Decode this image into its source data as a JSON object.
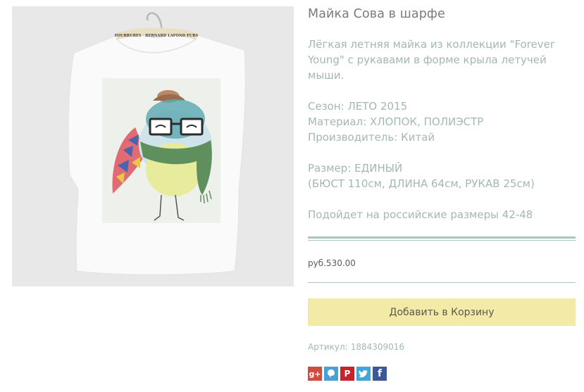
{
  "product": {
    "title": "Майка Сова в шарфе",
    "description": [
      "Лёгкая летняя майка из коллекции \"Forever Young\" с рукавами в форме крыла летучей мыши.",
      "",
      "Сезон: ЛЕТО 2015",
      "Материал: ХЛОПОК, ПОЛИЭСТР",
      "Производитель: Китай",
      "",
      "Размер: ЕДИНЫЙ",
      "(БЮСТ 110см, ДЛИНА 64см, РУКАВ 25см)",
      "",
      "Подойдет на российские размеры 42-48"
    ],
    "price": "руб.530.00",
    "add_to_cart_label": "Добавить в Корзину",
    "sku_label": "Артикул:",
    "sku_value": "1884309016",
    "hanger_label": "FOURRURES · BERNARD LAFOND FURS"
  },
  "social": [
    {
      "name": "google-plus-icon",
      "glyph": "g+"
    },
    {
      "name": "speech-bubble-icon",
      "glyph": ""
    },
    {
      "name": "pinterest-icon",
      "glyph": "P"
    },
    {
      "name": "twitter-icon",
      "glyph": ""
    },
    {
      "name": "facebook-icon",
      "glyph": "f"
    }
  ],
  "colors": {
    "button_bg": "#f4eaa7",
    "text_muted": "#a3b8b2",
    "rule": "#adc3bd",
    "title": "#7a7a7a"
  }
}
